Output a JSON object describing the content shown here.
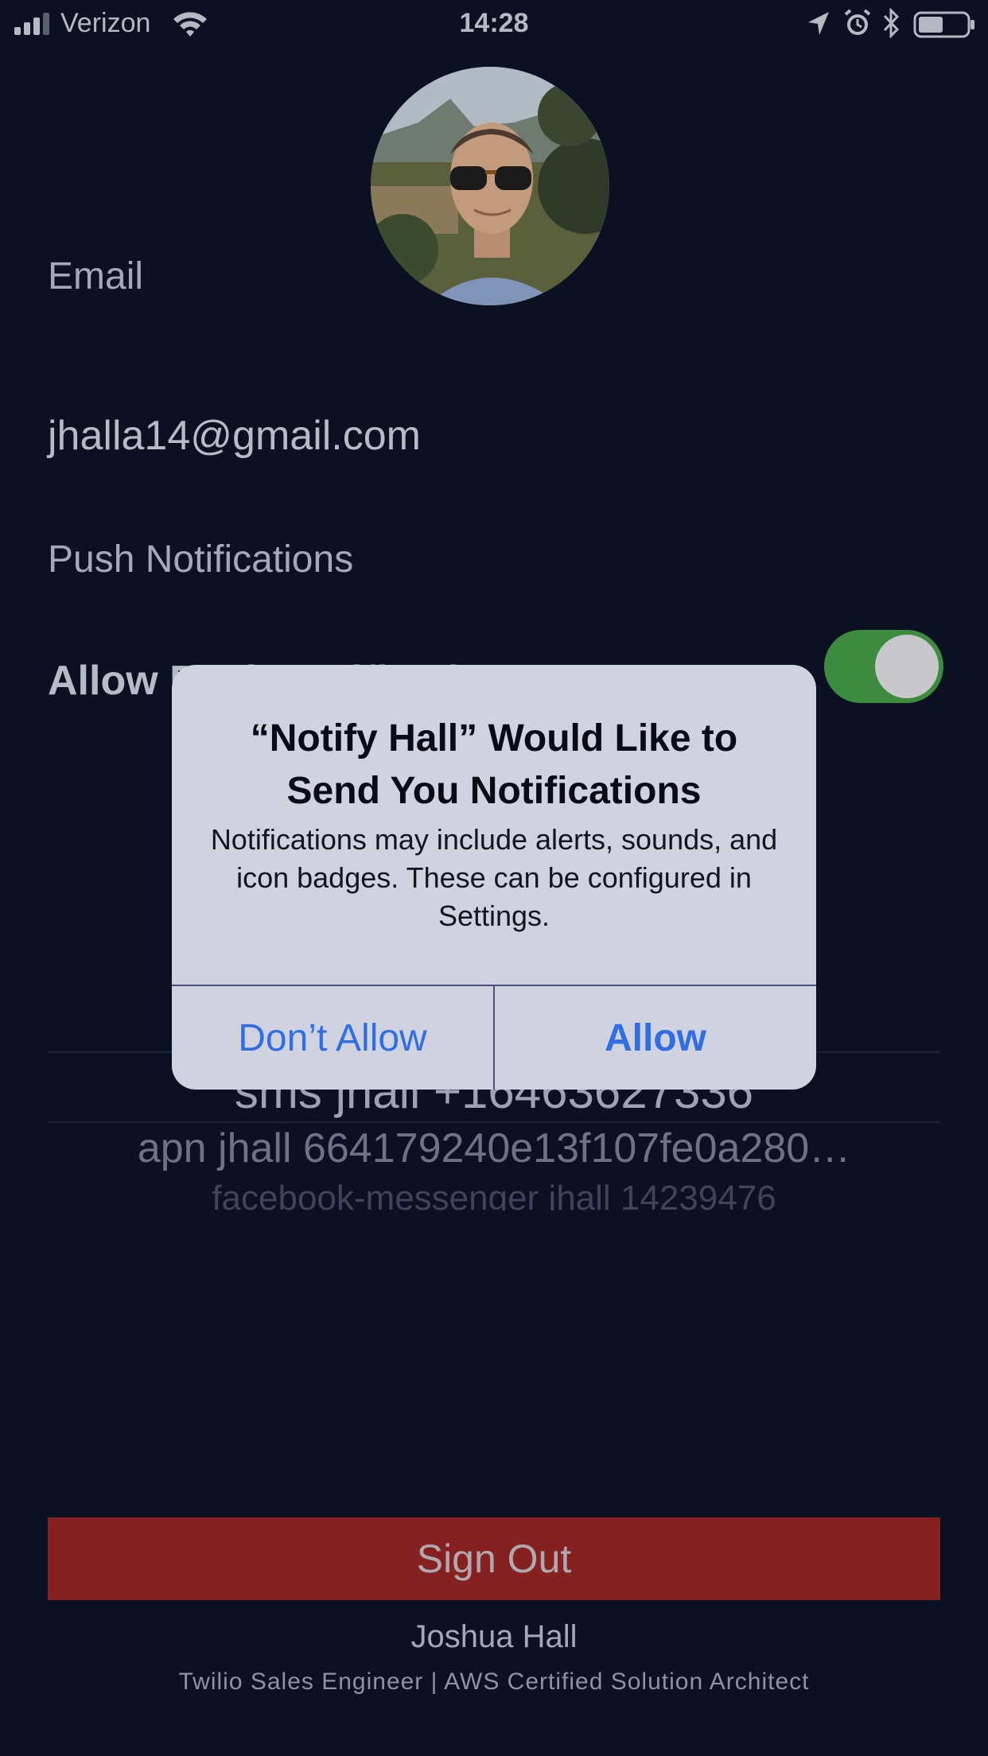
{
  "status_bar": {
    "carrier": "Verizon",
    "time": "14:28"
  },
  "profile": {
    "email_label": "Email",
    "email_value": "jhalla14@gmail.com",
    "push_label": "Push Notifications",
    "allow_push_label": "Allow Push Notifications",
    "allow_push_enabled": true
  },
  "bindings_picker": {
    "items": [
      "sms jhall +16463627336",
      "apn jhall 664179240e13f107fe0a280…",
      "facebook-messenger jhall 14239476"
    ]
  },
  "sign_out_label": "Sign Out",
  "footer": {
    "name": "Joshua Hall",
    "title": "Twilio Sales Engineer | AWS Certified Solution Architect"
  },
  "alert": {
    "title": "“Notify Hall” Would Like to Send You Notifications",
    "message": "Notifications may include alerts, sounds, and icon badges. These can be configured in Settings.",
    "dont_allow_label": "Don’t Allow",
    "allow_label": "Allow"
  },
  "colors": {
    "background": "#0b1022",
    "toggle_on": "#3d8b3f",
    "sign_out": "#852221",
    "alert_button": "#2f6fe3"
  }
}
